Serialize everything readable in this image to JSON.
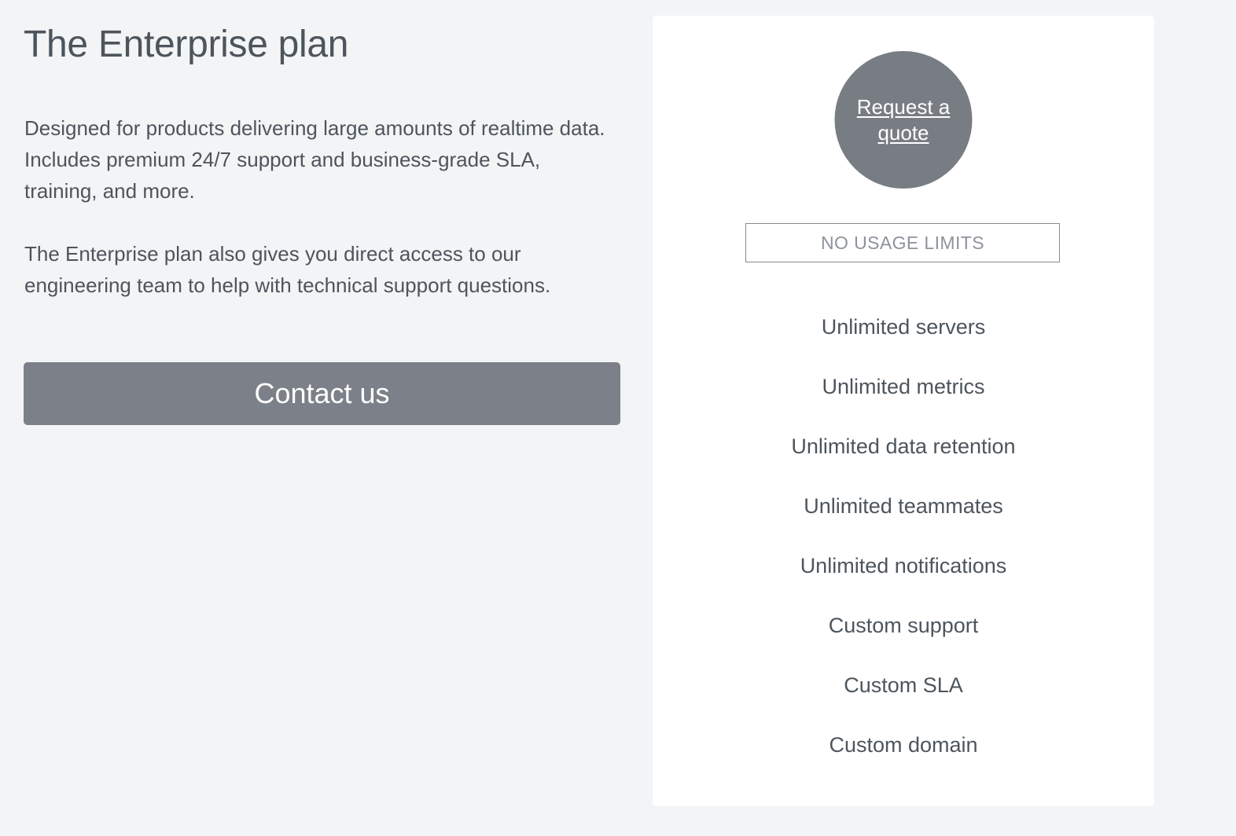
{
  "theme": {
    "page_background": "#f3f4f6",
    "card_background": "#ffffff",
    "accent_gray": "#7c8088",
    "circle_gray": "#787c83",
    "text_color": "#4d555c",
    "muted_text_color": "#8d939b",
    "border_color": "#858a92"
  },
  "plan": {
    "title": "The Enterprise plan",
    "paragraphs": [
      "Designed for products delivering large amounts of realtime data. Includes premium 24/7 support and business-grade SLA, training, and more.",
      "The Enterprise plan also gives you direct access to our engineering team to help with technical support questions."
    ],
    "cta_label": "Contact us"
  },
  "card": {
    "quote_badge": {
      "line1": "Request",
      "line2": "a quote",
      "label": "Request a quote"
    },
    "usage_label": "NO USAGE LIMITS",
    "features": [
      "Unlimited servers",
      "Unlimited metrics",
      "Unlimited data retention",
      "Unlimited teammates",
      "Unlimited notifications",
      "Custom support",
      "Custom SLA",
      "Custom domain"
    ]
  }
}
